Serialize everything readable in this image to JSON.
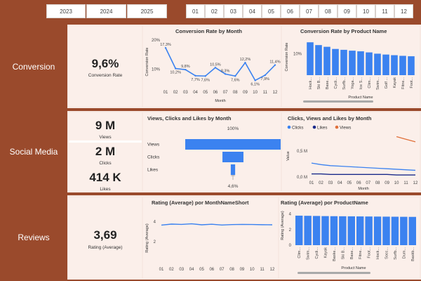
{
  "years": [
    "2023",
    "2024",
    "2025"
  ],
  "months": [
    "01",
    "02",
    "03",
    "04",
    "05",
    "06",
    "07",
    "08",
    "09",
    "10",
    "11",
    "12"
  ],
  "colors": {
    "accent": "#3b82f0",
    "brand": "#9a4a2c",
    "navy": "#1a2a8a",
    "orange": "#e0703a",
    "panel": "#fbefea"
  },
  "sections": {
    "conversion": "Conversion",
    "social": "Social Media",
    "reviews": "Reviews"
  },
  "kpi": {
    "conv_value": "9,6%",
    "conv_label": "Conversion Rate",
    "views_value": "9 M",
    "views_label": "Views",
    "clicks_value": "2 M",
    "clicks_label": "Clicks",
    "likes_value": "414 K",
    "likes_label": "Likes",
    "rating_value": "3,69",
    "rating_label": "Rating (Average)"
  },
  "titles": {
    "conv_month": "Conversion Rate by Month",
    "conv_product": "Conversion Rate by Product Name",
    "funnel": "Views, Clicks and Likes by Month",
    "cvl": "Clicks, Views and Likes by Month",
    "rating_month": "Rating (Average) por MonthNameShort",
    "rating_product": "Rating (Average) por ProductName"
  },
  "axis": {
    "conv_y": "Conversion Rate",
    "month_x": "Month",
    "product_x": "Product Name",
    "value_y": "Value",
    "rating_y": "Rating (Average)"
  },
  "chart_data": [
    {
      "type": "line",
      "title": "Conversion Rate by Month",
      "xlabel": "Month",
      "ylabel": "Conversion Rate",
      "categories": [
        "01",
        "02",
        "03",
        "04",
        "05",
        "06",
        "07",
        "08",
        "09",
        "10",
        "11",
        "12"
      ],
      "values": [
        17.3,
        10.2,
        9.8,
        7.7,
        7.6,
        10.5,
        8.3,
        7.6,
        12.2,
        6.1,
        7.9,
        11.4
      ],
      "labels": [
        "17,3%",
        "10,2%",
        "9,8%",
        "7,7%",
        "7,6%",
        "10,5%",
        "8,3%",
        "7,6%",
        "12,2%",
        "6,1%",
        "7,9%",
        "11,4%"
      ],
      "yticks": [
        "10%",
        "20%"
      ],
      "ylim": [
        5,
        20
      ]
    },
    {
      "type": "bar",
      "title": "Conversion Rate by Product Name",
      "xlabel": "Product Name",
      "ylabel": "Conversion Rate",
      "categories": [
        "Hock...",
        "Ski B...",
        "Base...",
        "Cycli...",
        "Surfb...",
        "Yoga...",
        "Ice S...",
        "Clim...",
        "Swim...",
        "Golf ...",
        "Kayak",
        "Fitne...",
        "Foot..."
      ],
      "values": [
        15.3,
        14.0,
        13.2,
        12.2,
        11.8,
        11.4,
        11.1,
        10.6,
        10.0,
        9.6,
        9.3,
        9.0,
        8.8
      ],
      "yticks": [
        "10%"
      ],
      "ylim": [
        0,
        17
      ]
    },
    {
      "type": "bar",
      "title": "Views, Clicks and Likes by Month",
      "categories": [
        "Views",
        "Clicks",
        "Likes"
      ],
      "values": [
        100,
        22,
        4.6
      ],
      "labels": [
        "100%",
        "",
        "4,6%"
      ]
    },
    {
      "type": "line",
      "title": "Clicks, Views and Likes by Month",
      "xlabel": "Month",
      "ylabel": "Value",
      "categories": [
        "01",
        "02",
        "03",
        "04",
        "05",
        "06",
        "07",
        "08",
        "09",
        "10",
        "11",
        "12"
      ],
      "series": [
        {
          "name": "Clicks",
          "values": [
            0.27,
            0.24,
            0.22,
            0.21,
            0.2,
            0.19,
            0.18,
            0.17,
            0.16,
            0.15,
            0.14,
            0.13
          ]
        },
        {
          "name": "Likes",
          "values": [
            0.06,
            0.06,
            0.05,
            0.05,
            0.05,
            0.05,
            0.05,
            0.05,
            0.05,
            0.04,
            0.04,
            0.04
          ]
        },
        {
          "name": "Views",
          "values": [
            null,
            null,
            null,
            null,
            null,
            null,
            null,
            null,
            null,
            0.78,
            0.73,
            0.68
          ]
        }
      ],
      "yticks": [
        "0,0 M",
        "0,5 M"
      ],
      "ylim": [
        0,
        0.95
      ]
    },
    {
      "type": "line",
      "title": "Rating (Average) por MonthNameShort",
      "ylabel": "Rating (Average)",
      "categories": [
        "01",
        "02",
        "03",
        "04",
        "05",
        "06",
        "07",
        "08",
        "09",
        "10",
        "11",
        "12"
      ],
      "values": [
        3.65,
        3.75,
        3.72,
        3.78,
        3.68,
        3.74,
        3.66,
        3.7,
        3.72,
        3.71,
        3.69,
        3.68
      ],
      "yticks": [
        "2",
        "4"
      ],
      "ylim": [
        0,
        5
      ]
    },
    {
      "type": "bar",
      "title": "Rating (Average) por ProductName",
      "xlabel": "Product Name",
      "ylabel": "Rating (Average)",
      "categories": [
        "Clim...",
        "Swim...",
        "Cycli...",
        "Kayak",
        "Baske...",
        "Ski B...",
        "Base...",
        "Fitne...",
        "Foot...",
        "Hock...",
        "Socc...",
        "Surfb...",
        "Dum...",
        "Baskb..."
      ],
      "values": [
        3.8,
        3.78,
        3.76,
        3.74,
        3.73,
        3.72,
        3.71,
        3.7,
        3.69,
        3.68,
        3.67,
        3.66,
        3.65,
        3.64
      ],
      "yticks": [
        "0",
        "2",
        "4"
      ],
      "ylim": [
        0,
        4.7
      ]
    }
  ]
}
